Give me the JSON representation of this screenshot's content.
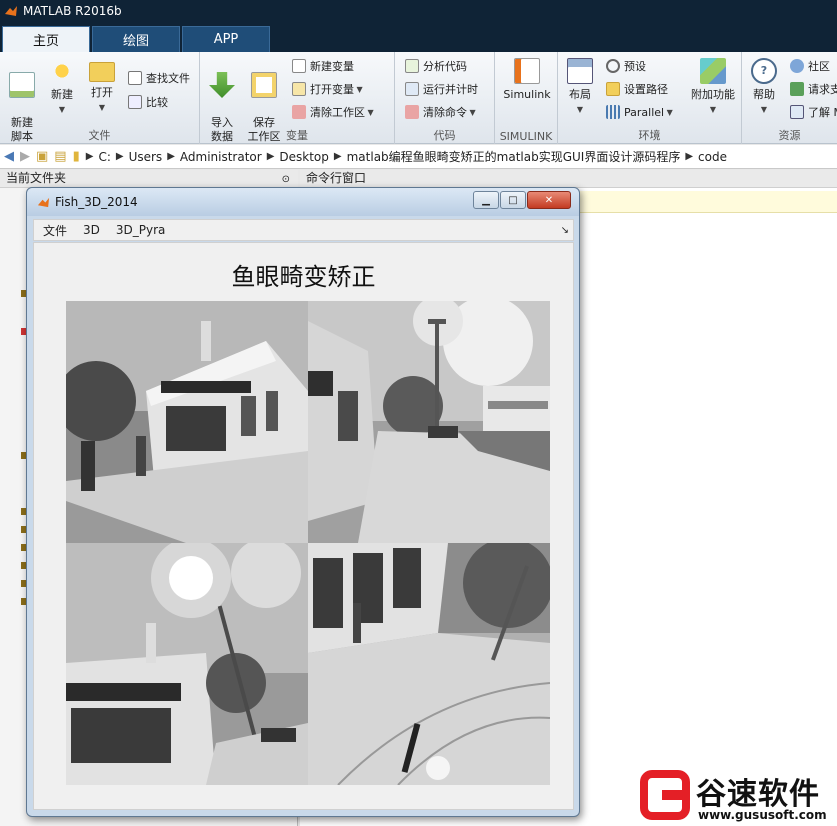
{
  "app": {
    "title": "MATLAB R2016b"
  },
  "tabs": [
    {
      "label": "主页",
      "active": true
    },
    {
      "label": "绘图",
      "active": false
    },
    {
      "label": "APP",
      "active": false
    }
  ],
  "ribbon": {
    "file": {
      "label": "文件",
      "new_script": "新建\n脚本",
      "new": "新建",
      "open": "打开",
      "find_files": "查找文件",
      "compare": "比较"
    },
    "variable": {
      "label": "变量",
      "import": "导入\n数据",
      "save_workspace": "保存\n工作区",
      "new_variable": "新建变量",
      "open_variable": "打开变量",
      "clear_workspace": "清除工作区"
    },
    "code": {
      "label": "代码",
      "analyze": "分析代码",
      "run_time": "运行并计时",
      "clear_commands": "清除命令"
    },
    "simulink": {
      "label": "SIMULINK",
      "button": "Simulink"
    },
    "environment": {
      "label": "环境",
      "layout": "布局",
      "preferences": "预设",
      "set_path": "设置路径",
      "parallel": "Parallel",
      "addons": "附加功能"
    },
    "resources": {
      "label": "资源",
      "help": "帮助",
      "community": "社区",
      "request": "请求支",
      "learn": "了解 M"
    }
  },
  "address": {
    "crumbs": [
      "C:",
      "Users",
      "Administrator",
      "Desktop",
      "matlab编程鱼眼畸变矫正的matlab实现GUI界面设计源码程序",
      "code"
    ]
  },
  "panels": {
    "current_folder": "当前文件夹",
    "command_window": "命令行窗口"
  },
  "figure": {
    "title": "Fish_3D_2014",
    "menu": [
      "文件",
      "3D",
      "3D_Pyra"
    ],
    "heading": "鱼眼畸变矫正"
  },
  "watermark": {
    "brand": "谷速软件",
    "url": "www.gususoft.com"
  },
  "colors": {
    "titlebar": "#0f2336",
    "tab_inactive": "#1f4d78",
    "brand_red": "#e41f26"
  }
}
